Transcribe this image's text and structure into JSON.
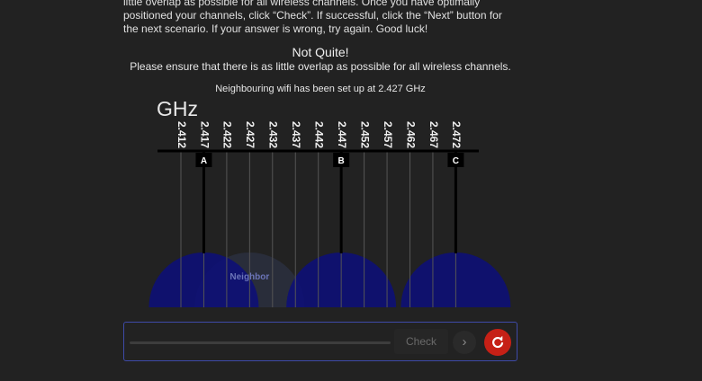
{
  "instructions": {
    "line1": "little overlap as possible for all wireless channels. Once you have optimally",
    "line2": "positioned your channels, click “Check”. If successful, click the “Next” button for",
    "line3": "the next scenario. If your answer is wrong, try again. Good luck!"
  },
  "result": {
    "title": "Not Quite!",
    "message": "Please ensure that there is as little overlap as possible for all wireless channels."
  },
  "neighbour_note": "Neighbouring wifi has been set up at 2.427 GHz",
  "diagram": {
    "unit_label": "GHz",
    "frequencies": [
      "2.412",
      "2.417",
      "2.422",
      "2.427",
      "2.432",
      "2.437",
      "2.442",
      "2.447",
      "2.452",
      "2.457",
      "2.462",
      "2.467",
      "2.472"
    ],
    "channels": [
      {
        "label": "A",
        "frequency": "2.417"
      },
      {
        "label": "B",
        "frequency": "2.447"
      },
      {
        "label": "C",
        "frequency": "2.472"
      }
    ],
    "neighbor": {
      "label": "Neighbor",
      "frequency": "2.427"
    },
    "colors": {
      "channel_fill": "#0d0f78",
      "neighbor_fill": "#2a2f3e",
      "neighbor_text": "#6b74b8",
      "axis": "#000000",
      "gridline": "#555555"
    }
  },
  "toolbar": {
    "check_label": "Check",
    "next_icon": "chevron-right-icon",
    "retry_icon": "refresh-icon",
    "retry_color": "#c62016",
    "border_color": "#3e4aa8"
  }
}
